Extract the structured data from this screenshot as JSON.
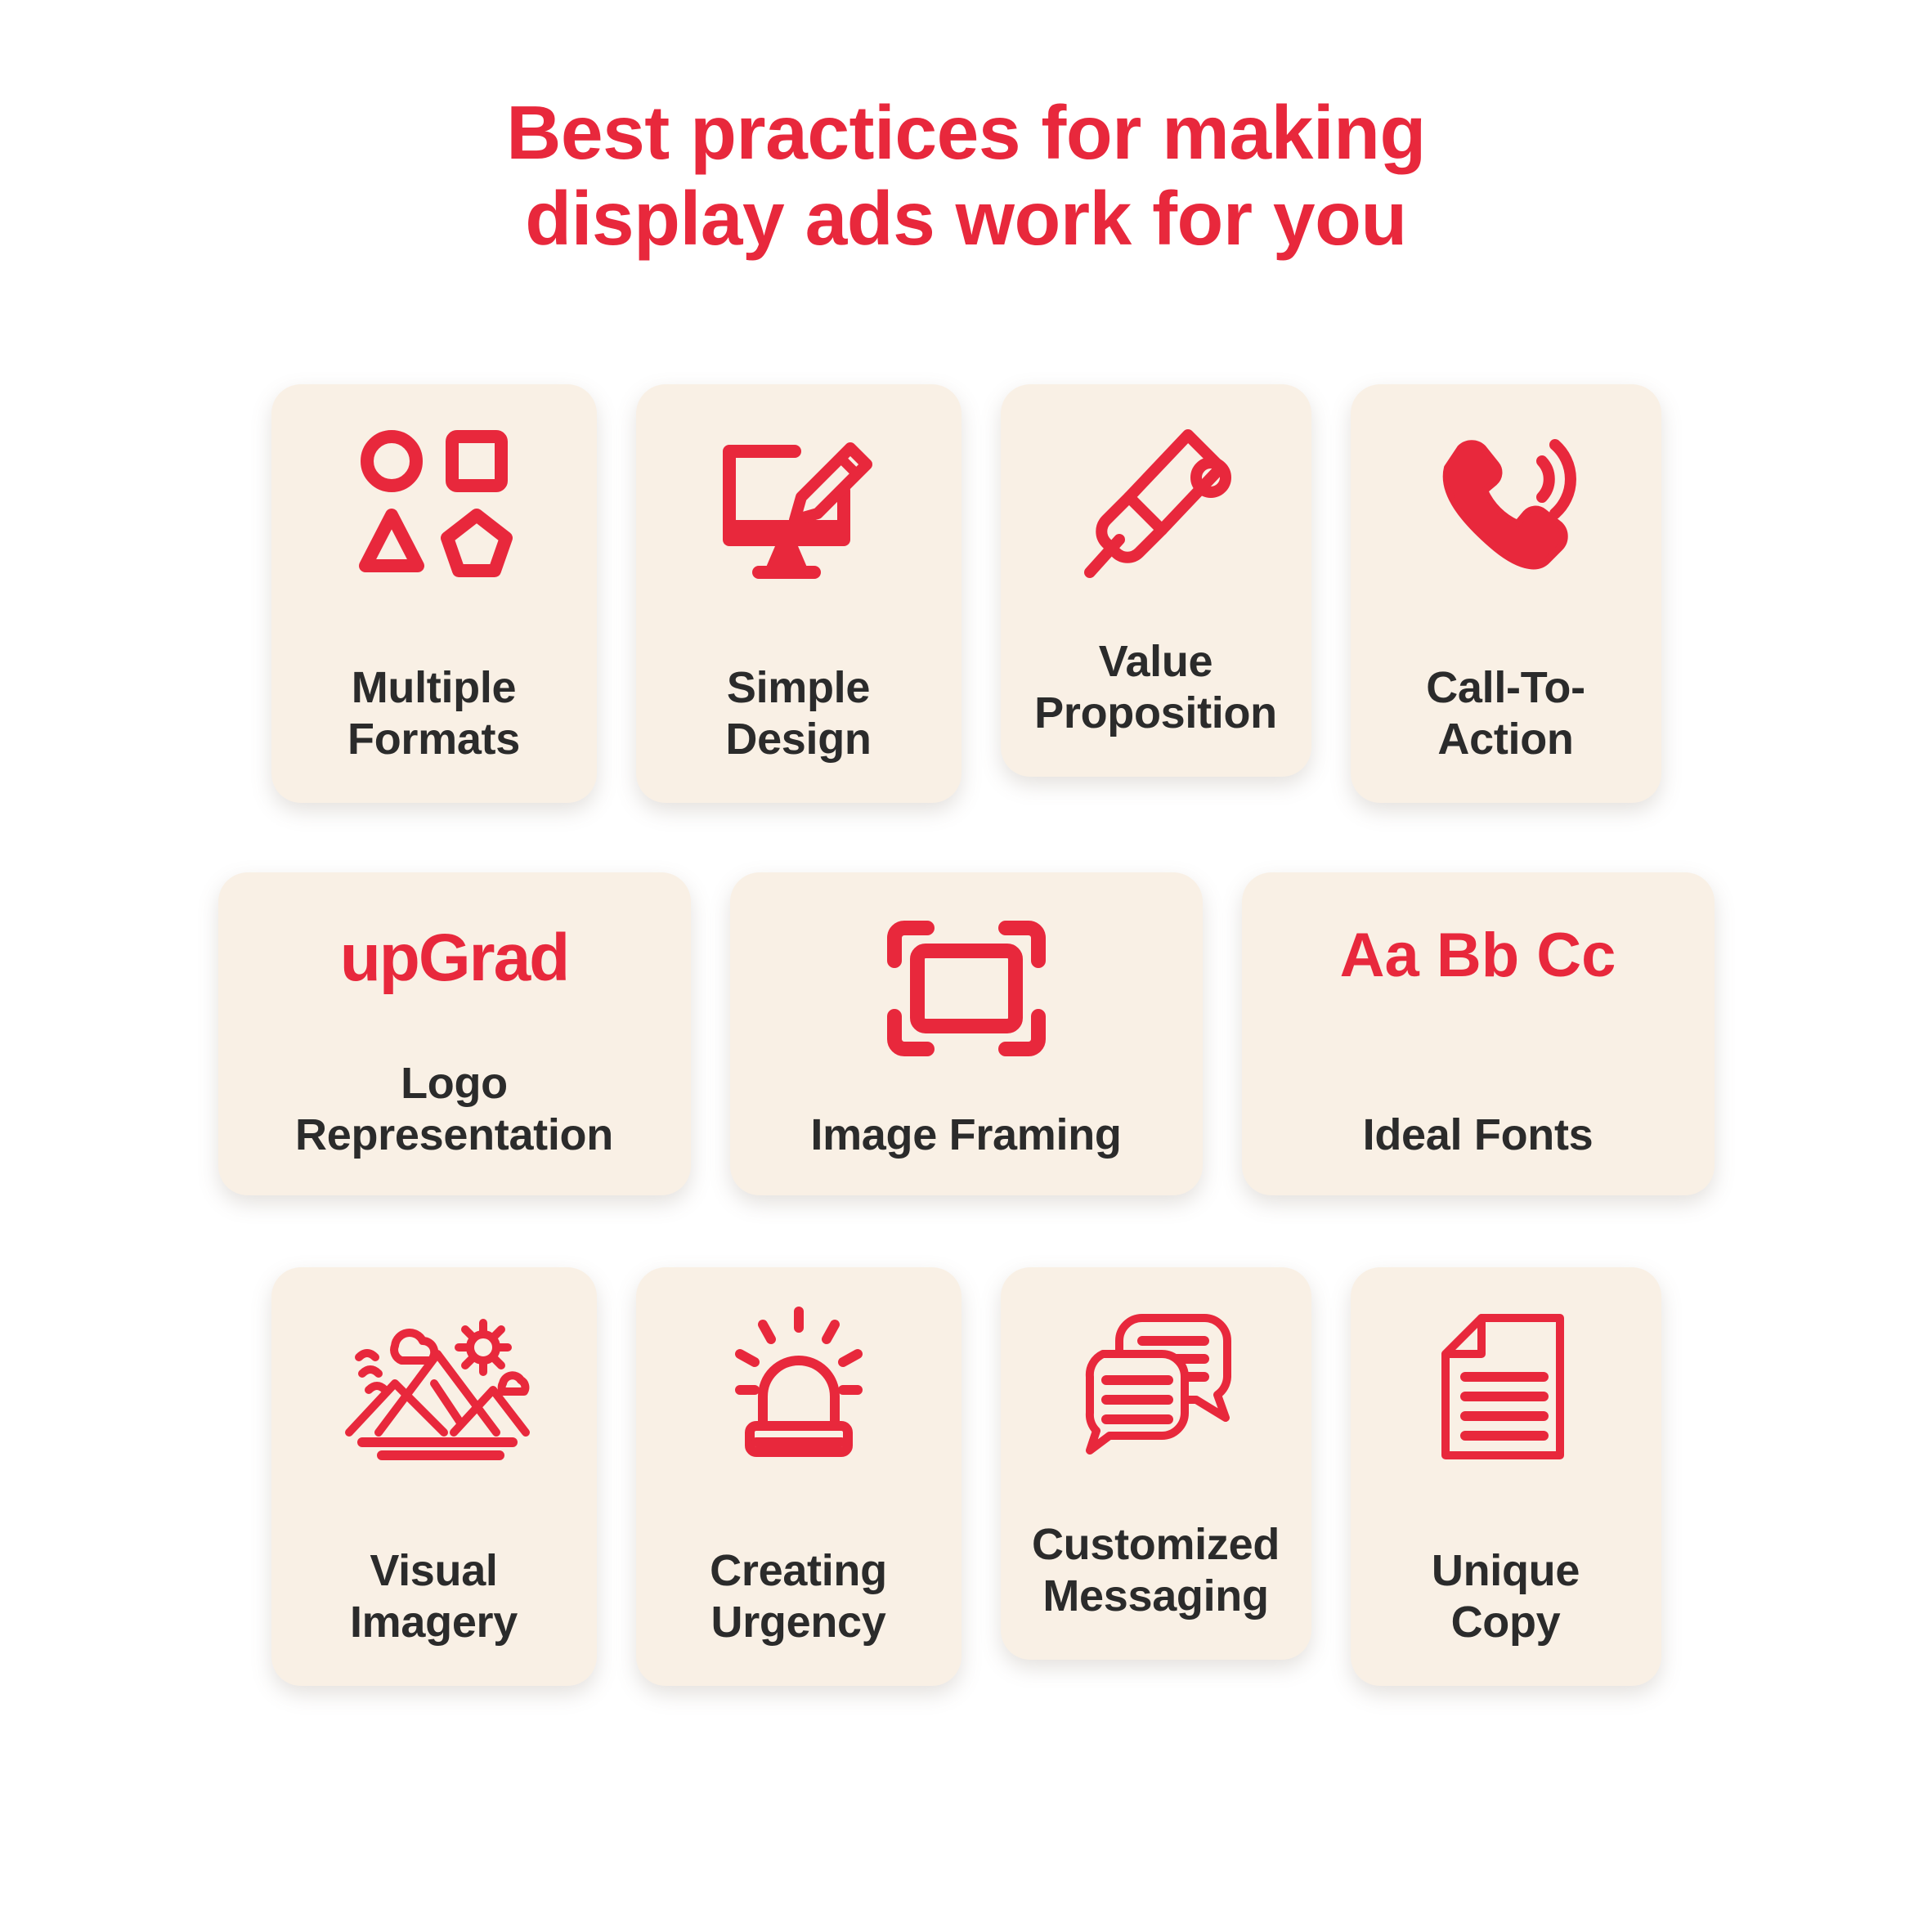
{
  "colors": {
    "accent_red": "#E8283C",
    "card_background": "#F9F0E5",
    "page_background": "#FFFFFF",
    "label_text": "#2B2B2B"
  },
  "title": {
    "line1": "Best practices for making",
    "line2": "display ads work for you"
  },
  "rows": [
    {
      "cards": [
        {
          "icon": "shapes-icon",
          "label_line1": "Multiple",
          "label_line2": "Formats"
        },
        {
          "icon": "monitor-pencil-icon",
          "label_line1": "Simple",
          "label_line2": "Design"
        },
        {
          "icon": "megaphone-icon",
          "label_line1": "Value",
          "label_line2": "Proposition"
        },
        {
          "icon": "phone-ring-icon",
          "label_line1": "Call-To-",
          "label_line2": "Action"
        }
      ]
    },
    {
      "cards": [
        {
          "icon": "upgrad-logo",
          "logo_text": "upGrad",
          "label_line1": "Logo",
          "label_line2": "Representation"
        },
        {
          "icon": "image-frame-icon",
          "label_line1": "Image Framing",
          "label_line2": ""
        },
        {
          "icon": "font-sample",
          "sample_text": "Aa Bb Cc",
          "label_line1": "Ideal Fonts",
          "label_line2": ""
        }
      ]
    },
    {
      "cards": [
        {
          "icon": "mountain-landscape-icon",
          "label_line1": "Visual",
          "label_line2": "Imagery"
        },
        {
          "icon": "siren-icon",
          "label_line1": "Creating",
          "label_line2": "Urgency"
        },
        {
          "icon": "chat-bubbles-icon",
          "label_line1": "Customized",
          "label_line2": "Messaging"
        },
        {
          "icon": "document-icon",
          "label_line1": "Unique",
          "label_line2": "Copy"
        }
      ]
    }
  ]
}
